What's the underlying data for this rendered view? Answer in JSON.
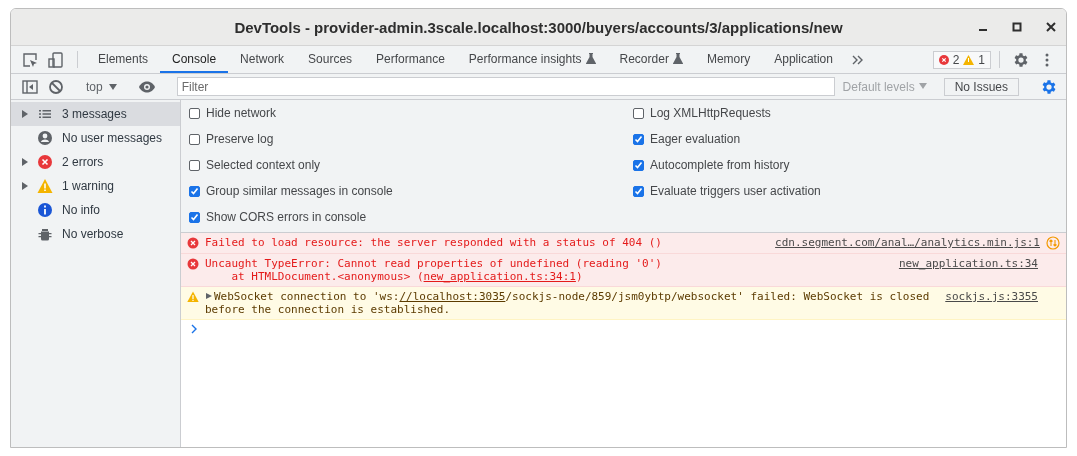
{
  "window": {
    "title": "DevTools - provider-admin.3scale.localhost:3000/buyers/accounts/3/applications/new"
  },
  "tabs": [
    {
      "label": "Elements",
      "selected": false,
      "experimental": false
    },
    {
      "label": "Console",
      "selected": true,
      "experimental": false
    },
    {
      "label": "Network",
      "selected": false,
      "experimental": false
    },
    {
      "label": "Sources",
      "selected": false,
      "experimental": false
    },
    {
      "label": "Performance",
      "selected": false,
      "experimental": false
    },
    {
      "label": "Performance insights",
      "selected": false,
      "experimental": true
    },
    {
      "label": "Recorder",
      "selected": false,
      "experimental": true
    },
    {
      "label": "Memory",
      "selected": false,
      "experimental": false
    },
    {
      "label": "Application",
      "selected": false,
      "experimental": false
    }
  ],
  "counts": {
    "errors": "2",
    "warnings": "1"
  },
  "toolbar": {
    "context": "top",
    "filter_placeholder": "Filter",
    "levels": "Default levels",
    "issues": "No Issues"
  },
  "sidebar": {
    "items": [
      {
        "label": "3 messages",
        "kind": "messages",
        "expandable": true,
        "selected": true
      },
      {
        "label": "No user messages",
        "kind": "user",
        "expandable": false,
        "selected": false
      },
      {
        "label": "2 errors",
        "kind": "error",
        "expandable": true,
        "selected": false
      },
      {
        "label": "1 warning",
        "kind": "warning",
        "expandable": true,
        "selected": false
      },
      {
        "label": "No info",
        "kind": "info",
        "expandable": false,
        "selected": false
      },
      {
        "label": "No verbose",
        "kind": "verbose",
        "expandable": false,
        "selected": false
      }
    ]
  },
  "settings": {
    "left": [
      {
        "label": "Hide network",
        "checked": false
      },
      {
        "label": "Preserve log",
        "checked": false
      },
      {
        "label": "Selected context only",
        "checked": false
      },
      {
        "label": "Group similar messages in console",
        "checked": true
      },
      {
        "label": "Show CORS errors in console",
        "checked": true
      }
    ],
    "right": [
      {
        "label": "Log XMLHttpRequests",
        "checked": false
      },
      {
        "label": "Eager evaluation",
        "checked": true
      },
      {
        "label": "Autocomplete from history",
        "checked": true
      },
      {
        "label": "Evaluate triggers user activation",
        "checked": true
      }
    ]
  },
  "messages": [
    {
      "kind": "error",
      "expandable": false,
      "network": true,
      "source": "cdn.segment.com/anal…/analytics.min.js:1",
      "lines": [
        [
          {
            "text": "Failed to load resource: the server responded with a status of 404 ()"
          }
        ]
      ]
    },
    {
      "kind": "error",
      "expandable": false,
      "network": false,
      "source": "new_application.ts:34",
      "lines": [
        [
          {
            "text": "Uncaught TypeError: Cannot read properties of undefined (reading '0')"
          }
        ],
        [
          {
            "text": "    at HTMLDocument.<anonymous> ("
          },
          {
            "text": "new_application.ts:34:1",
            "link": true
          },
          {
            "text": ")"
          }
        ]
      ]
    },
    {
      "kind": "warning",
      "expandable": true,
      "network": false,
      "source": "sockjs.js:3355",
      "lines": [
        [
          {
            "text": "WebSocket connection to 'ws:"
          },
          {
            "text": "//localhost:3035",
            "link": true
          },
          {
            "text": "/sockjs-node/859/jsm0ybtp/websocket' failed: WebSocket is closed before the connection is established."
          }
        ]
      ]
    }
  ]
}
